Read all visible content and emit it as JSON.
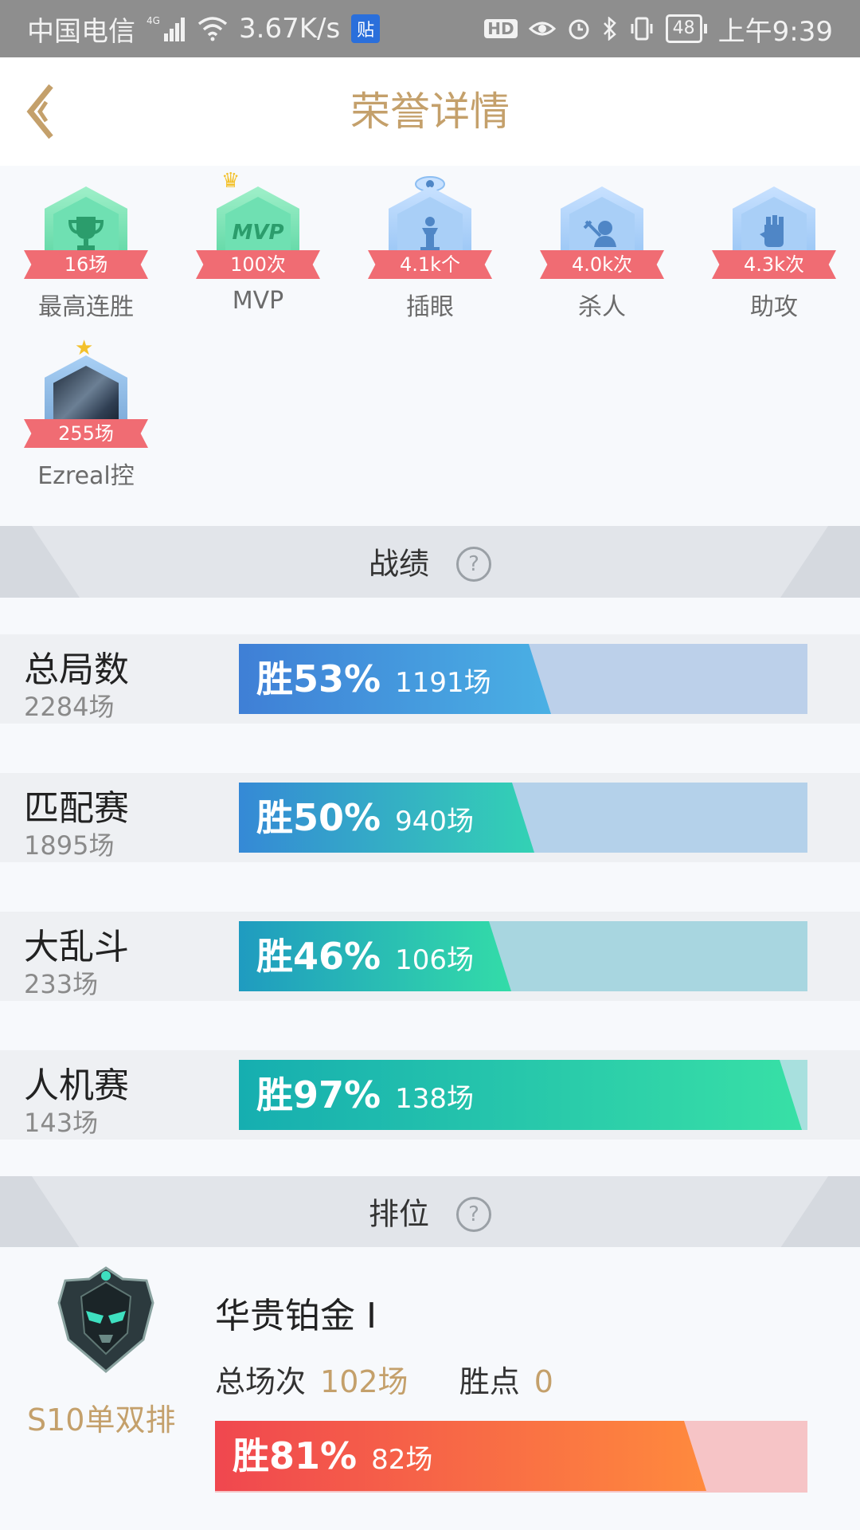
{
  "status_bar": {
    "carrier": "中国电信",
    "network": "4G",
    "speed": "3.67K/s",
    "notification_icon": "贴",
    "hd": "HD",
    "battery": "48",
    "time": "上午9:39"
  },
  "header": {
    "title": "荣誉详情"
  },
  "badges": [
    {
      "value": "16场",
      "label": "最高连胜",
      "icon": "trophy-icon"
    },
    {
      "value": "100次",
      "label": "MVP",
      "icon": "mvp-icon",
      "inner_text": "MVP"
    },
    {
      "value": "4.1k个",
      "label": "插眼",
      "icon": "ward-icon"
    },
    {
      "value": "4.0k次",
      "label": "杀人",
      "icon": "kill-icon"
    },
    {
      "value": "4.3k次",
      "label": "助攻",
      "icon": "assist-icon"
    },
    {
      "value": "255场",
      "label": "Ezreal控",
      "icon": "champion-avatar"
    }
  ],
  "sections": {
    "record": {
      "title": "战绩"
    },
    "rank": {
      "title": "排位"
    }
  },
  "stats": [
    {
      "name": "总局数",
      "count": "2284场",
      "win_label": "胜53%",
      "wins": "1191场",
      "win_rate": 53,
      "colors": [
        "#3f7fd6",
        "#4ab0e4"
      ],
      "track": "#bcd0ea"
    },
    {
      "name": "匹配赛",
      "count": "1895场",
      "win_label": "胜50%",
      "wins": "940场",
      "win_rate": 50,
      "colors": [
        "#3589d6",
        "#33d2b4"
      ],
      "track": "#b4d1ea"
    },
    {
      "name": "大乱斗",
      "count": "233场",
      "win_label": "胜46%",
      "wins": "106场",
      "win_rate": 46,
      "colors": [
        "#1f9bc0",
        "#33dca8"
      ],
      "track": "#a8d6e0"
    },
    {
      "name": "人机赛",
      "count": "143场",
      "win_label": "胜97%",
      "wins": "138场",
      "win_rate": 97,
      "colors": [
        "#16aeb0",
        "#38e0a6"
      ],
      "track": "#a8e0de"
    }
  ],
  "rank": {
    "season": "S10单双排",
    "tier": "华贵铂金 I",
    "total_label": "总场次",
    "total_value": "102场",
    "points_label": "胜点",
    "points_value": "0",
    "win_label": "胜81%",
    "wins": "82场",
    "win_rate": 81,
    "colors": [
      "#f0474f",
      "#ff8a3d"
    ],
    "track": "#f6c4c6"
  }
}
